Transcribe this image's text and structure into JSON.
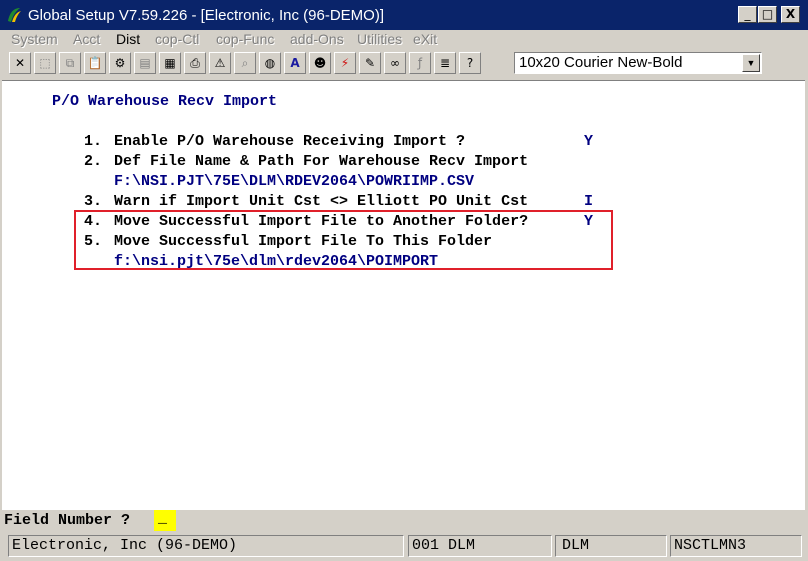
{
  "window": {
    "title": "Global Setup V7.59.226 - [Electronic, Inc (96-DEMO)]",
    "controls": [
      "_",
      "□",
      "X"
    ]
  },
  "menu": [
    {
      "label": "System",
      "enabled": false
    },
    {
      "label": "Acct",
      "enabled": false
    },
    {
      "label": "Dist",
      "enabled": true
    },
    {
      "label": "cop-Ctl",
      "enabled": false
    },
    {
      "label": "cop-Func",
      "enabled": false
    },
    {
      "label": "add-Ons",
      "enabled": false
    },
    {
      "label": "Utilities",
      "enabled": false
    },
    {
      "label": "eXit",
      "enabled": false
    }
  ],
  "toolbar": {
    "font_select": "10x20 Courier New-Bold",
    "icons": [
      "close-icon",
      "select-icon",
      "copy-icon",
      "paste-icon",
      "settings-icon",
      "properties-icon",
      "notes-icon",
      "print-icon",
      "alert-icon",
      "search-icon",
      "globe-icon",
      "text-icon",
      "user-icon",
      "lightning-icon",
      "edit-icon",
      "link-icon",
      "function-icon",
      "list-icon",
      "help-icon"
    ]
  },
  "screen": {
    "heading": "P/O Warehouse Recv Import",
    "lines": [
      {
        "num": "1.",
        "label": "Enable P/O Warehouse Receiving Import ?",
        "value": "Y"
      },
      {
        "num": "2.",
        "label": "Def File Name & Path For Warehouse Recv Import",
        "value": ""
      },
      {
        "num": "",
        "label": "",
        "value": "F:\\NSI.PJT\\75E\\DLM\\RDEV2064\\POWRIIMP.CSV"
      },
      {
        "num": "3.",
        "label": "Warn if Import Unit Cst <> Elliott PO Unit Cst",
        "value": "I"
      },
      {
        "num": "4.",
        "label": "Move Successful Import File to Another Folder?",
        "value": "Y"
      },
      {
        "num": "5.",
        "label": "Move Successful Import File To This Folder",
        "value": ""
      },
      {
        "num": "",
        "label": "",
        "value": "f:\\nsi.pjt\\75e\\dlm\\rdev2064\\POIMPORT"
      }
    ]
  },
  "prompt": {
    "label": "Field Number ?",
    "cursor": "_"
  },
  "status": {
    "company": "Electronic, Inc (96-DEMO)",
    "user_code": "001 DLM",
    "user": "DLM",
    "program": "NSCTLMN3"
  }
}
